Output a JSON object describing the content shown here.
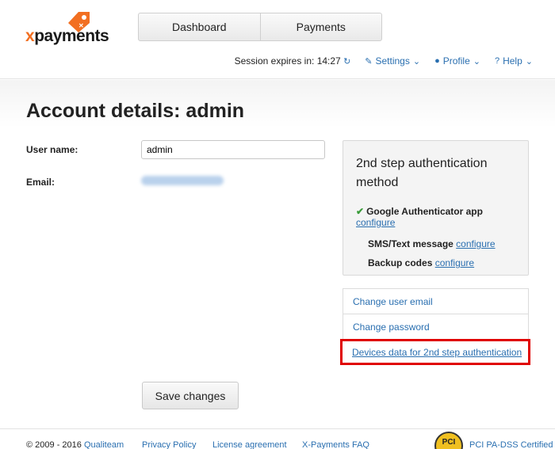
{
  "brand": {
    "name_prefix": "x",
    "name_rest": "payments",
    "accent": "#f26f21"
  },
  "nav": {
    "items": [
      {
        "label": "Dashboard"
      },
      {
        "label": "Payments"
      }
    ]
  },
  "session": {
    "label": "Session expires in:",
    "time": "14:27"
  },
  "menus": {
    "settings": "Settings",
    "profile": "Profile",
    "help": "Help"
  },
  "page": {
    "title": "Account details: admin"
  },
  "form": {
    "username_label": "User name:",
    "username_value": "admin",
    "email_label": "Email:",
    "save_label": "Save changes"
  },
  "auth": {
    "title": "2nd step authentication method",
    "methods": [
      {
        "name": "Google Authenticator app",
        "action": "configure",
        "active": true
      },
      {
        "name": "SMS/Text message",
        "action": "configure",
        "active": false
      },
      {
        "name": "Backup codes",
        "action": "configure",
        "active": false
      }
    ]
  },
  "links": [
    {
      "label": "Change user email"
    },
    {
      "label": "Change password"
    },
    {
      "label": "Devices data for 2nd step authentication"
    }
  ],
  "footer": {
    "copyright": "© 2009 - 2016",
    "links": [
      "Qualiteam",
      "Privacy Policy",
      "License agreement",
      "X-Payments FAQ"
    ],
    "badge": "PCI",
    "pci": "PCI PA-DSS Certified"
  },
  "icons": {
    "refresh": "refresh-icon",
    "settings": "wrench-icon",
    "profile": "user-icon",
    "help": "question-circle-icon",
    "check": "check-icon"
  },
  "colors": {
    "link": "#2a6fb0",
    "highlight": "#e00000",
    "check": "#3a9c3a"
  }
}
